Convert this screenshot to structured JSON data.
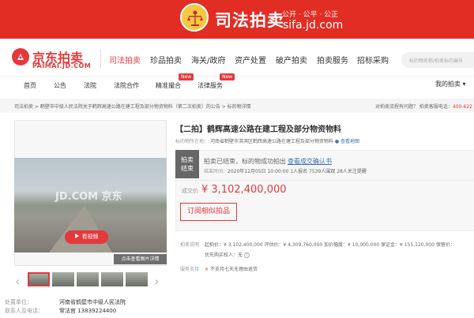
{
  "banner": {
    "title": "司法拍卖",
    "slogan": "公开 · 公平 · 公正",
    "url": "sifa.jd.com"
  },
  "logo": {
    "name": "京东拍卖",
    "url": "PAIMAI.JD.COM"
  },
  "mainnav": [
    "司法拍卖",
    "珍品拍卖",
    "海关/政府",
    "资产处置",
    "破产拍卖",
    "拍卖服务",
    "招标采购"
  ],
  "search": {
    "placeholder": "标的物名称/拍卖标的编号"
  },
  "subnav": [
    "首页",
    "公告",
    "法院",
    "法院合作",
    "精准撮合",
    "法律服务"
  ],
  "badges": {
    "b1": "New",
    "b2": "New"
  },
  "mybid": "我的拍卖 ▾",
  "breadcrumb": "司法拍卖 > 鹤壁市中级人民法院关于鹤辉高速公路在建工程及部分物资物料（第二次拍卖）的公告 > 标的物详情",
  "contact": {
    "text": "对拍卖流程有问题？ 拍卖客服电话：",
    "phone": "400-622"
  },
  "gallery": {
    "watermark": "JD.COM 京东",
    "video": "看视频",
    "viewmore": "点击查看图片详情"
  },
  "disposal": {
    "label1": "处置单位：",
    "value1": "河南省鹤壁市中级人民法院",
    "label2": "联系人及电话：",
    "value2": "常法官 13839224400"
  },
  "item": {
    "title": "【二拍】鹤辉高速公路在建工程及部分物资物料",
    "loc_label": "标的物所在地：",
    "loc_value": "河南省鹤壁市淇滨区鹤辉高速公路在建工程及部分物资物料",
    "map": "● 查看地图"
  },
  "status": {
    "line1": "拍卖",
    "line2": "结束"
  },
  "result": {
    "ended": "拍卖已结束，标的物成功拍出",
    "docs": "查看成交确认书",
    "stats_label": "结束时间：",
    "stats_value": "2020年12月05日 10:00:00   1人报名   7539人围观   28人关注提醒"
  },
  "deal": {
    "label": "成交价",
    "price": "¥ 3,102,400,000"
  },
  "subscribe": "订阅相似拍品",
  "params": {
    "label": "拍卖说明",
    "row1": "起拍价：¥ 3,102,400,000    评估价：¥ 4,309,760,000    加价幅度：¥ 10,000,000    保证金：¥ 155,120,000    保留价：",
    "row2": "优先购买权人：无"
  },
  "service": {
    "label": "服务支持",
    "value": "不支持七天无理由退货",
    "x": "✕"
  }
}
